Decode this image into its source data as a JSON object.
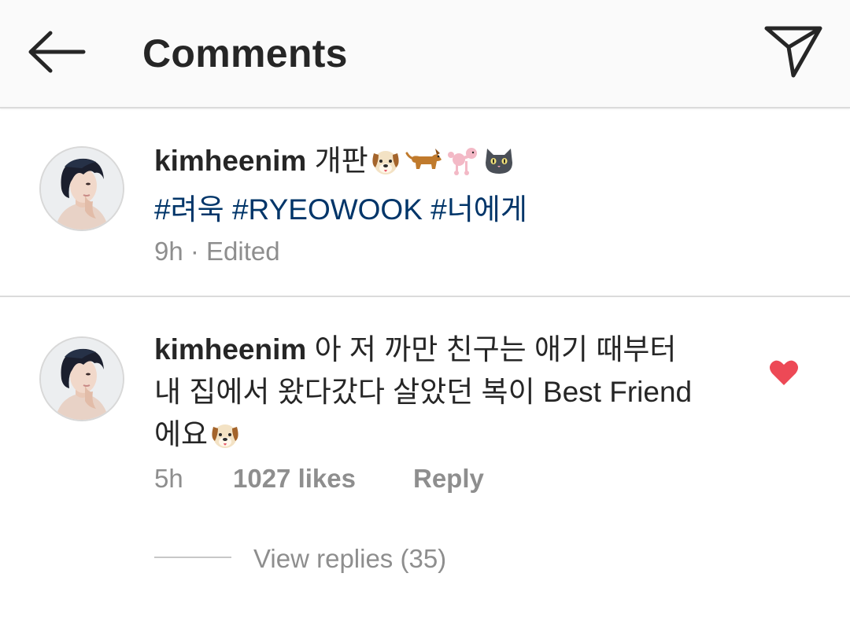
{
  "header": {
    "title": "Comments",
    "back_icon": "arrow-left-icon",
    "share_icon": "paper-plane-icon"
  },
  "caption": {
    "username": "kimheenim",
    "text": "개판",
    "emojis": [
      "dog-face",
      "dog",
      "poodle",
      "cat-face"
    ],
    "hashtags": [
      "#려욱",
      "#RYEOWOOK",
      "#너에게"
    ],
    "time": "9h",
    "separator": " · ",
    "edited": "Edited"
  },
  "comment": {
    "username": "kimheenim",
    "line1": "아 저 까만 친구는 애기 때부터",
    "line2": "내 집에서 왔다갔다 살았던 복이 Best Friend",
    "line3": "에요",
    "emoji": "dog-face",
    "time": "5h",
    "likes": "1027 likes",
    "reply": "Reply",
    "liked": true,
    "view_replies": "View replies (35)"
  },
  "colors": {
    "hashtag": "#003569",
    "heart": "#ed4956",
    "meta": "#8e8e8e",
    "text": "#262626",
    "header_bg": "#fafafa"
  }
}
